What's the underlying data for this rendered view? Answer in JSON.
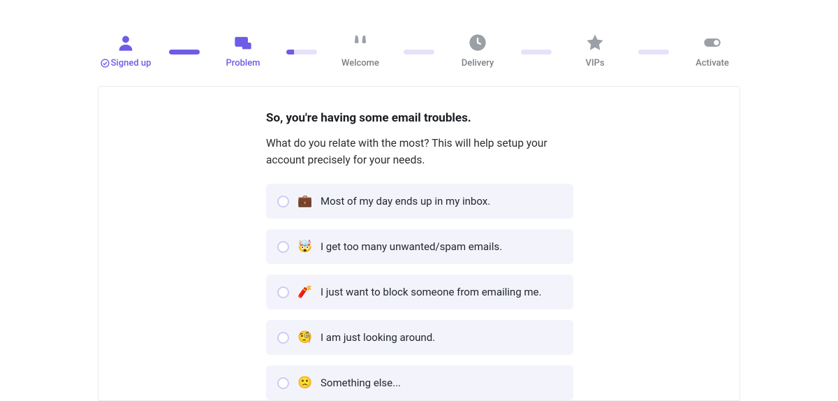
{
  "stepper": {
    "steps": [
      {
        "label": "Signed up",
        "state": "done",
        "icon": "user"
      },
      {
        "label": "Problem",
        "state": "active",
        "icon": "envelope"
      },
      {
        "label": "Welcome",
        "state": "pending",
        "icon": "cheers"
      },
      {
        "label": "Delivery",
        "state": "pending",
        "icon": "clock"
      },
      {
        "label": "VIPs",
        "state": "pending",
        "icon": "star"
      },
      {
        "label": "Activate",
        "state": "pending",
        "icon": "toggle"
      }
    ],
    "connectors": [
      "full",
      "partial",
      "empty",
      "empty",
      "empty"
    ]
  },
  "main": {
    "heading": "So, you're having some email troubles.",
    "subtext": "What do you relate with the most? This will help setup your account precisely for your needs.",
    "options": [
      {
        "emoji": "💼",
        "label": "Most of my day ends up in my inbox."
      },
      {
        "emoji": "🤯",
        "label": "I get too many unwanted/spam emails."
      },
      {
        "emoji": "🧨",
        "label": "I just want to block someone from emailing me."
      },
      {
        "emoji": "🧐",
        "label": "I am just looking around."
      },
      {
        "emoji": "🙁",
        "label": "Something else..."
      }
    ]
  }
}
